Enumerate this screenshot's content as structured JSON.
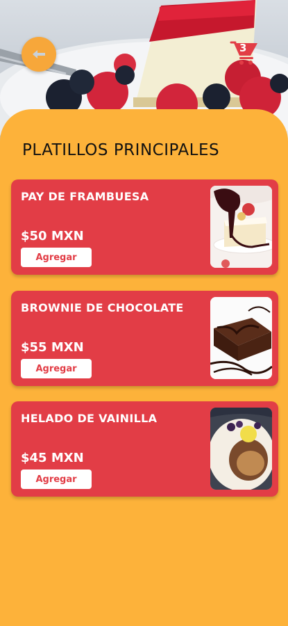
{
  "header": {
    "back_icon": "arrow-left-icon",
    "cart_icon": "cart-icon",
    "cart_count": "3"
  },
  "section": {
    "title": "PLATILLOS PRINCIPALES"
  },
  "items": [
    {
      "name": "PAY DE FRAMBUESA",
      "price": "$50 MXN",
      "button": "Agregar",
      "image": "raspberry-cheesecake"
    },
    {
      "name": "BROWNIE DE CHOCOLATE",
      "price": "$55 MXN",
      "button": "Agregar",
      "image": "chocolate-brownie"
    },
    {
      "name": "HELADO DE VAINILLA",
      "price": "$45 MXN",
      "button": "Agregar",
      "image": "vanilla-ice-cream"
    }
  ],
  "colors": {
    "background": "#fdb23a",
    "card": "#e23d46",
    "button_bg": "#ffffff",
    "back_button": "#f7a73a"
  }
}
